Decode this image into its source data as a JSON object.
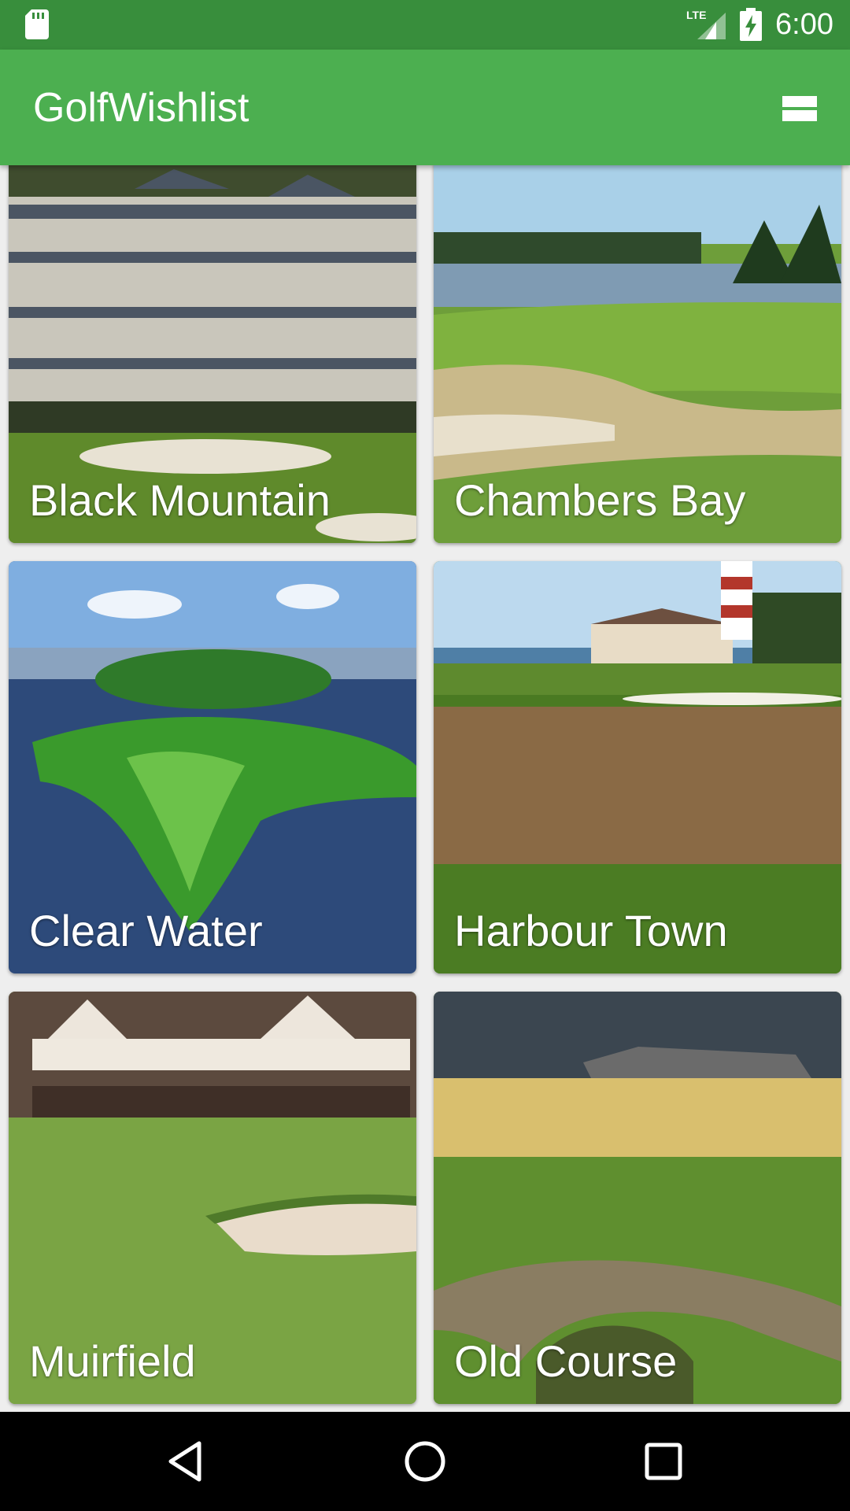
{
  "status_bar": {
    "time": "6:00",
    "network": "LTE",
    "icons": [
      "sd-card-icon",
      "lte-signal-icon",
      "battery-charging-icon"
    ]
  },
  "app_bar": {
    "title": "GolfWishlist",
    "action_icon": "view-list-toggle-icon"
  },
  "courses": [
    {
      "name": "Black Mountain"
    },
    {
      "name": "Chambers Bay"
    },
    {
      "name": "Clear Water"
    },
    {
      "name": "Harbour Town"
    },
    {
      "name": "Muirfield"
    },
    {
      "name": "Old Course"
    }
  ],
  "nav_bar": {
    "buttons": [
      "back-icon",
      "home-icon",
      "recents-icon"
    ]
  },
  "colors": {
    "status_bar": "#388E3C",
    "app_bar": "#4CAF50",
    "nav_bar": "#000000",
    "background": "#EEEEEE"
  }
}
